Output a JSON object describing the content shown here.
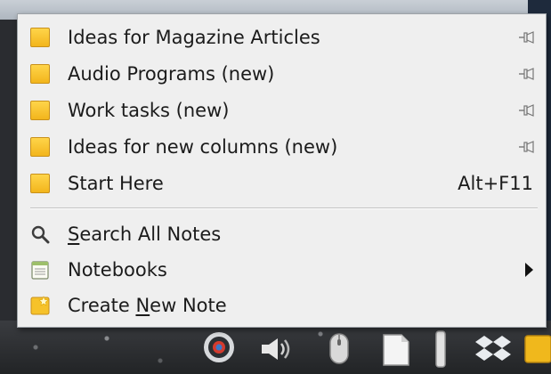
{
  "menu": {
    "notes": [
      {
        "label": "Ideas for Magazine Articles",
        "pinned": true
      },
      {
        "label": "Audio Programs (new)",
        "pinned": true
      },
      {
        "label": "Work tasks (new)",
        "pinned": true
      },
      {
        "label": "Ideas for new columns (new)",
        "pinned": true
      },
      {
        "label": "Start Here",
        "accel": "Alt+F11",
        "pinned": false
      }
    ],
    "search": {
      "pre": "",
      "mnemonic": "S",
      "post": "earch All Notes"
    },
    "notebooks": {
      "label": "Notebooks"
    },
    "create": {
      "pre": "Create ",
      "mnemonic": "N",
      "post": "ew Note"
    }
  },
  "colors": {
    "menu_bg": "#efefef",
    "note_icon": "#f2b51c"
  },
  "icons": {
    "note": "note-icon",
    "pin": "pin-icon",
    "search": "search-icon",
    "notebook": "notebook-icon",
    "new_note": "new-note-icon",
    "submenu": "submenu-arrow-icon"
  }
}
